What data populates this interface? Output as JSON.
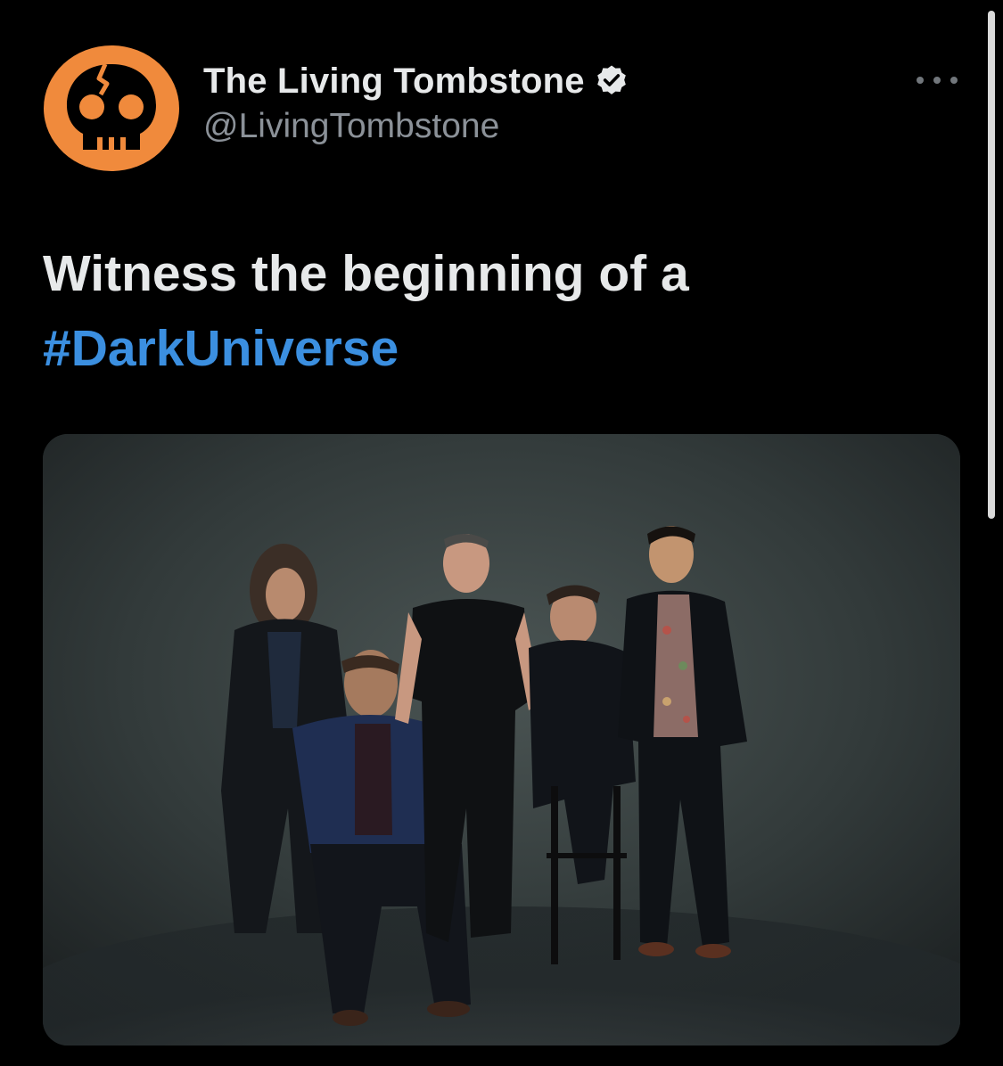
{
  "author": {
    "display_name": "The Living Tombstone",
    "handle": "@LivingTombstone",
    "verified": true,
    "avatar_icon": "orange-skull-logo-icon",
    "avatar_color": "#f08a3c"
  },
  "tweet": {
    "text_plain": "Witness the beginning of a",
    "hashtag": "#DarkUniverse",
    "hashtag_color": "#3b8fe0"
  },
  "media": {
    "type": "photo"
  },
  "icons": {
    "verified": "verified-badge-icon",
    "more": "more-options-icon"
  }
}
